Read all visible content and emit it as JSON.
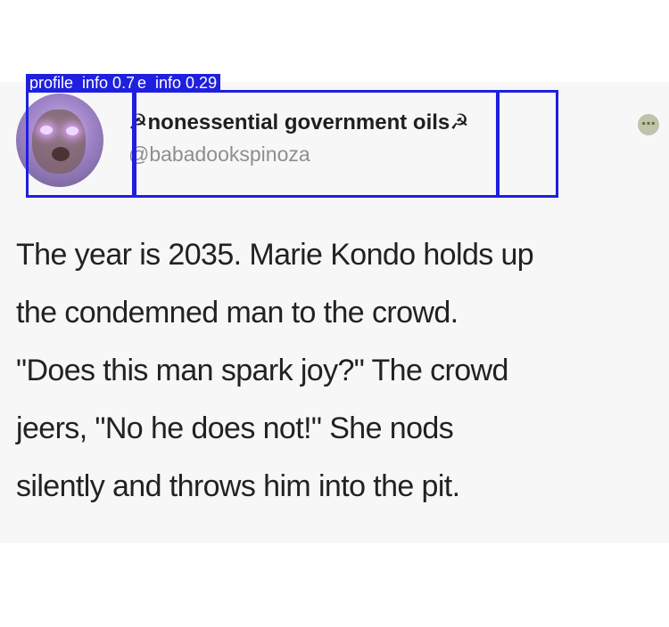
{
  "overlay": {
    "profile_label": "profile_info 0.76",
    "name_label": "e_info 0.29"
  },
  "tweet": {
    "display_name": "☭nonessential government oils☭",
    "handle": "@babadookspinoza",
    "text_lines": [
      "The year is 2035. Marie Kondo holds up",
      "the condemned man to the crowd.",
      "\"Does this man spark joy?\" The crowd",
      "jeers, \"No he does not!\" She nods",
      "silently and throws him into the pit."
    ]
  },
  "icons": {
    "more": "more-options-icon"
  },
  "colors": {
    "overlay_blue": "#1f1fe0",
    "background": "#f7f7f7",
    "text": "#222222",
    "handle": "#8e8e8e"
  }
}
